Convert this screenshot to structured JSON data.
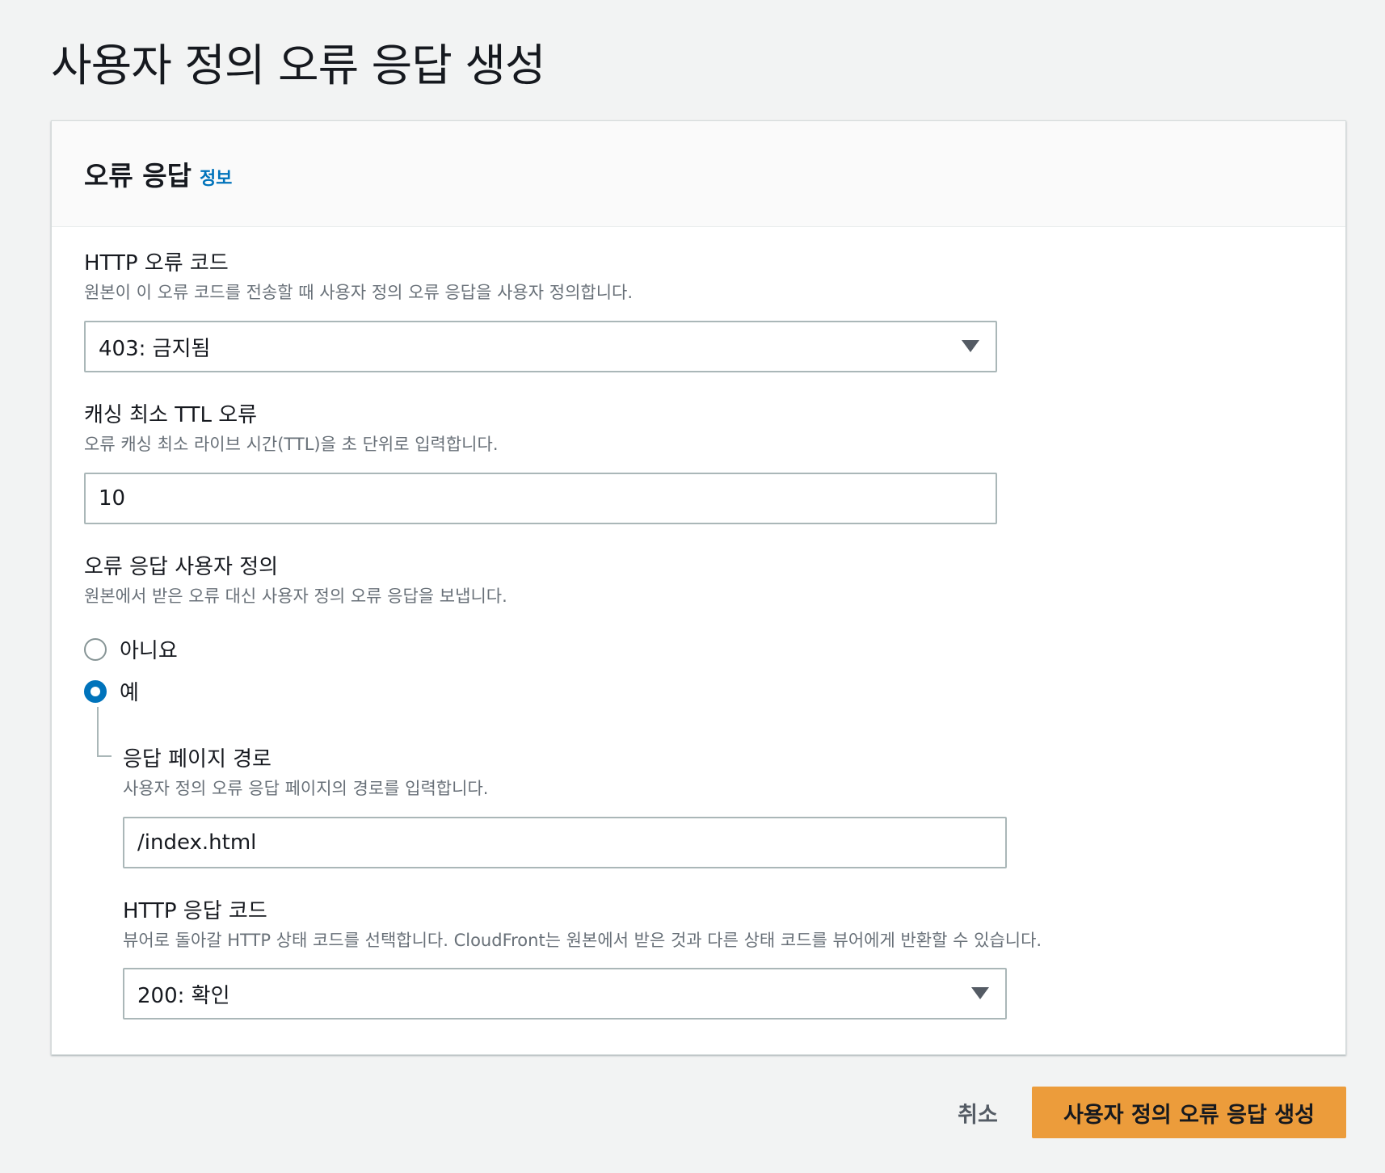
{
  "page": {
    "title": "사용자 정의 오류 응답 생성"
  },
  "panel": {
    "title": "오류 응답",
    "info_link": "정보",
    "http_error_code": {
      "label": "HTTP 오류 코드",
      "description": "원본이 이 오류 코드를 전송할 때 사용자 정의 오류 응답을 사용자 정의합니다.",
      "selected": "403: 금지됨"
    },
    "min_ttl": {
      "label": "캐싱 최소 TTL 오류",
      "description": "오류 캐싱 최소 라이브 시간(TTL)을 초 단위로 입력합니다.",
      "value": "10"
    },
    "customize": {
      "label": "오류 응답 사용자 정의",
      "description": "원본에서 받은 오류 대신 사용자 정의 오류 응답을 보냅니다.",
      "options": [
        {
          "label": "아니요",
          "checked": false
        },
        {
          "label": "예",
          "checked": true
        }
      ]
    },
    "response_page_path": {
      "label": "응답 페이지 경로",
      "description": "사용자 정의 오류 응답 페이지의 경로를 입력합니다.",
      "value": "/index.html"
    },
    "http_response_code": {
      "label": "HTTP 응답 코드",
      "description": "뷰어로 돌아갈 HTTP 상태 코드를 선택합니다. CloudFront는 원본에서 받은 것과 다른 상태 코드를 뷰어에게 반환할 수 있습니다.",
      "selected": "200: 확인"
    }
  },
  "actions": {
    "cancel_label": "취소",
    "submit_label": "사용자 정의 오류 응답 생성"
  },
  "colors": {
    "primary_button": "#ec9c3b",
    "link": "#0073bb",
    "radio_checked": "#0073bb"
  }
}
